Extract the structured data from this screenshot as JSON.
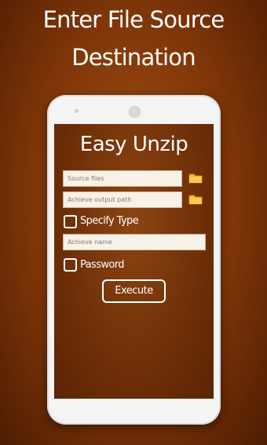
{
  "headline": {
    "line1": "Enter File Source",
    "line2": "Destination"
  },
  "app": {
    "title": "Easy Unzip",
    "source_placeholder": "Source files",
    "output_placeholder": "Achieve output path",
    "specify_type_label": "Specify Type",
    "archive_name_placeholder": "Achieve name",
    "password_label": "Password",
    "execute_label": "Execute"
  },
  "colors": {
    "background": "#7e3508",
    "screen": "#6a2c06",
    "folder_icon": "#f4b53a"
  }
}
